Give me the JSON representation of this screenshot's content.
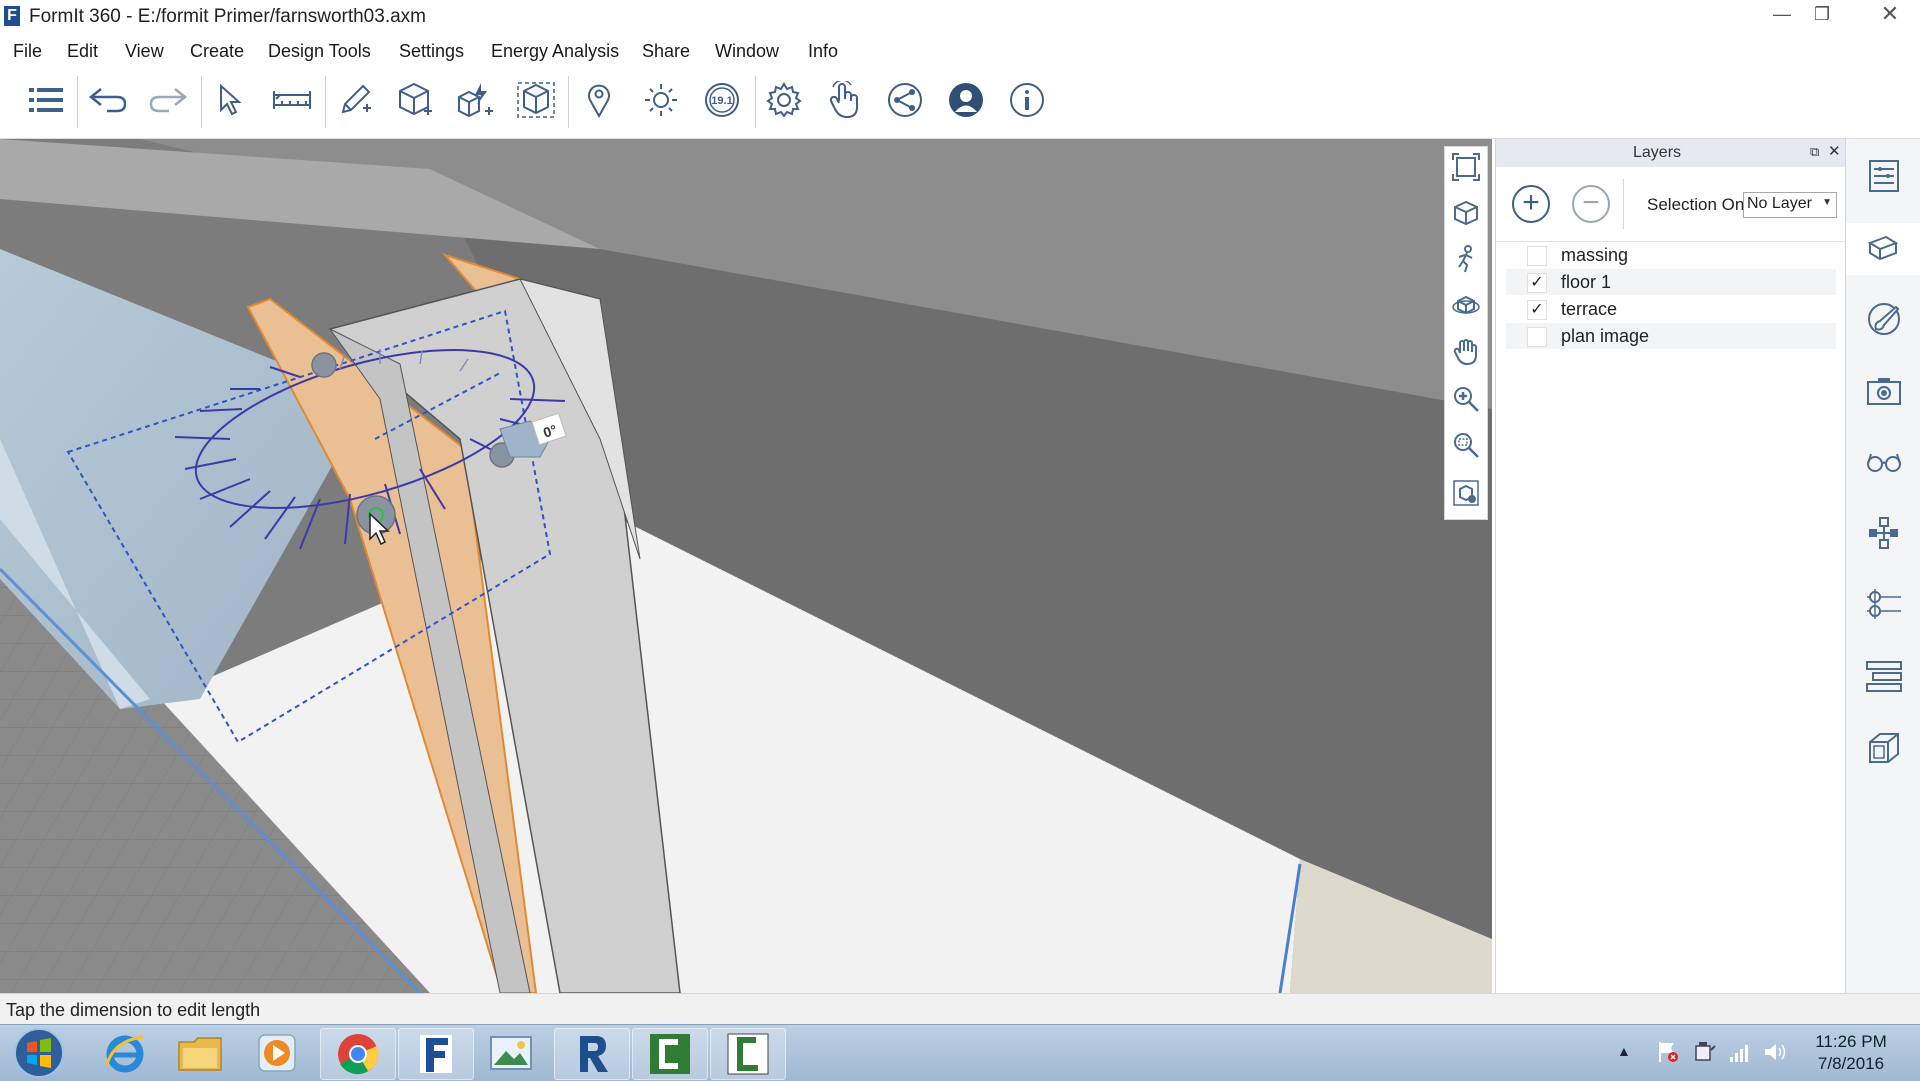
{
  "window": {
    "app_icon_letter": "F",
    "title": "FormIt 360 - E:/formit Primer/farnsworth03.axm",
    "minimize": "—",
    "maximize": "❐",
    "close": "✕"
  },
  "menu": [
    "File",
    "Edit",
    "View",
    "Create",
    "Design Tools",
    "Settings",
    "Energy Analysis",
    "Share",
    "Window",
    "Info"
  ],
  "toolbar": {
    "icons": [
      "list-icon",
      "undo-icon",
      "redo-icon",
      "select-arrow-icon",
      "measure-icon",
      "sketch-pencil-icon",
      "add-cube-icon",
      "add-cube-lightning-icon",
      "group-cube-icon",
      "location-pin-icon",
      "sun-icon",
      "version-badge-icon",
      "settings-gear-icon",
      "touch-gesture-icon",
      "share-icon",
      "user-profile-icon",
      "info-icon"
    ],
    "version_badge": "19.1"
  },
  "viewport": {
    "rotation_angle_label": "0°"
  },
  "nav_strip": {
    "icons": [
      "zoom-extents-icon",
      "view-cube-icon",
      "walk-icon",
      "orbit-icon",
      "pan-hand-icon",
      "zoom-in-icon",
      "zoom-window-icon",
      "camera-view-icon"
    ]
  },
  "layers": {
    "title": "Layers",
    "add_label": "+",
    "remove_label": "−",
    "selection_label": "Selection On",
    "selection_value": "No Layer",
    "items": [
      {
        "name": "massing",
        "checked": false,
        "check": ""
      },
      {
        "name": "floor 1",
        "checked": true,
        "check": "✓"
      },
      {
        "name": "terrace",
        "checked": true,
        "check": "✓"
      },
      {
        "name": "plan image",
        "checked": false,
        "check": ""
      }
    ]
  },
  "right_sidebar": {
    "icons": [
      "properties-icon",
      "layers-icon",
      "materials-brush-icon",
      "scenes-camera-icon",
      "view-glasses-icon",
      "groups-tree-icon",
      "levels-icon",
      "stacked-groups-icon",
      "object-cube-icon"
    ],
    "active": "layers-icon"
  },
  "status": {
    "message": "Tap the dimension to edit length"
  },
  "taskbar": {
    "apps": [
      "start-button",
      "internet-explorer",
      "file-explorer",
      "media-player",
      "chrome",
      "formit",
      "photos",
      "revit",
      "camtasia-recorder",
      "camtasia-studio"
    ],
    "time": "11:26 PM",
    "date": "7/8/2016"
  }
}
